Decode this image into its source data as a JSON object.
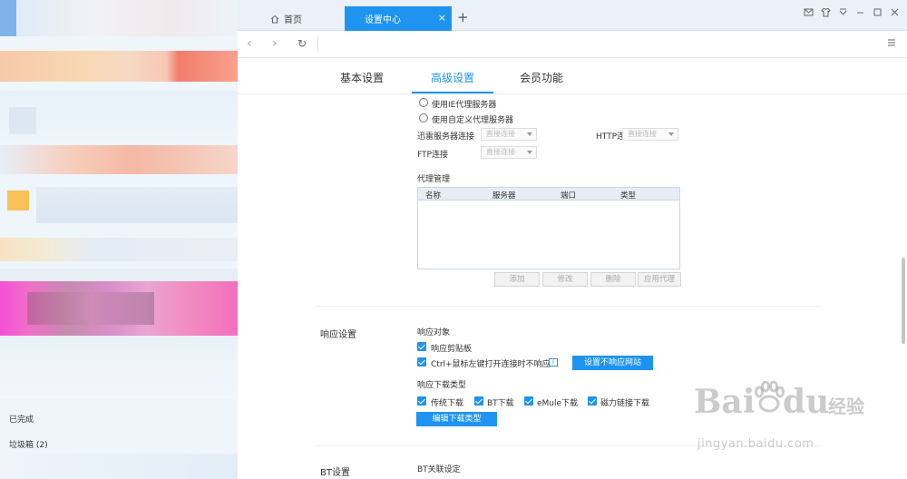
{
  "sidebar": {
    "completed_label": "已完成",
    "trash_label": "垃圾箱 (2)"
  },
  "tabs": {
    "home_label": "首页",
    "active_label": "设置中心",
    "close_glyph": "×",
    "new_glyph": "+"
  },
  "nav": {
    "back_glyph": "‹",
    "forward_glyph": "›",
    "refresh_glyph": "↻",
    "menu_glyph": "≡"
  },
  "settings_tabs": {
    "basic": "基本设置",
    "advanced": "高级设置",
    "member": "会员功能"
  },
  "proxy": {
    "option_ie": "使用IE代理服务器",
    "option_custom": "使用自定义代理服务器",
    "thunder_label": "迅雷服务器连接",
    "thunder_value": "直接连接",
    "http_label": "HTTP连接",
    "http_value": "直接连接",
    "ftp_label": "FTP连接",
    "ftp_value": "直接连接",
    "manage_title": "代理管理",
    "columns": [
      "名称",
      "服务器",
      "端口",
      "类型"
    ],
    "buttons": {
      "add": "添加",
      "edit": "修改",
      "delete": "删除",
      "apply": "应用代理"
    }
  },
  "response": {
    "section_title": "响应设置",
    "object_title": "响应对象",
    "clipboard": "响应剪贴板",
    "ctrl_click": "Ctrl+鼠标左键打开连接时不响应",
    "info_glyph": "i",
    "set_sites_button": "设置不响应网站",
    "download_types_title": "响应下载类型",
    "types": [
      "传统下载",
      "BT下载",
      "eMule下载",
      "磁力链接下载"
    ],
    "edit_types_button": "编辑下载类型"
  },
  "bt": {
    "section_title": "BT设置",
    "assoc_title": "BT关联设定"
  },
  "watermark": {
    "brand": "Bai",
    "brand2": "du",
    "suffix": "经验",
    "url": "jingyan.baidu.com"
  },
  "colors": {
    "accent": "#1e94f0",
    "tab_bar": "#eaf1f8"
  }
}
